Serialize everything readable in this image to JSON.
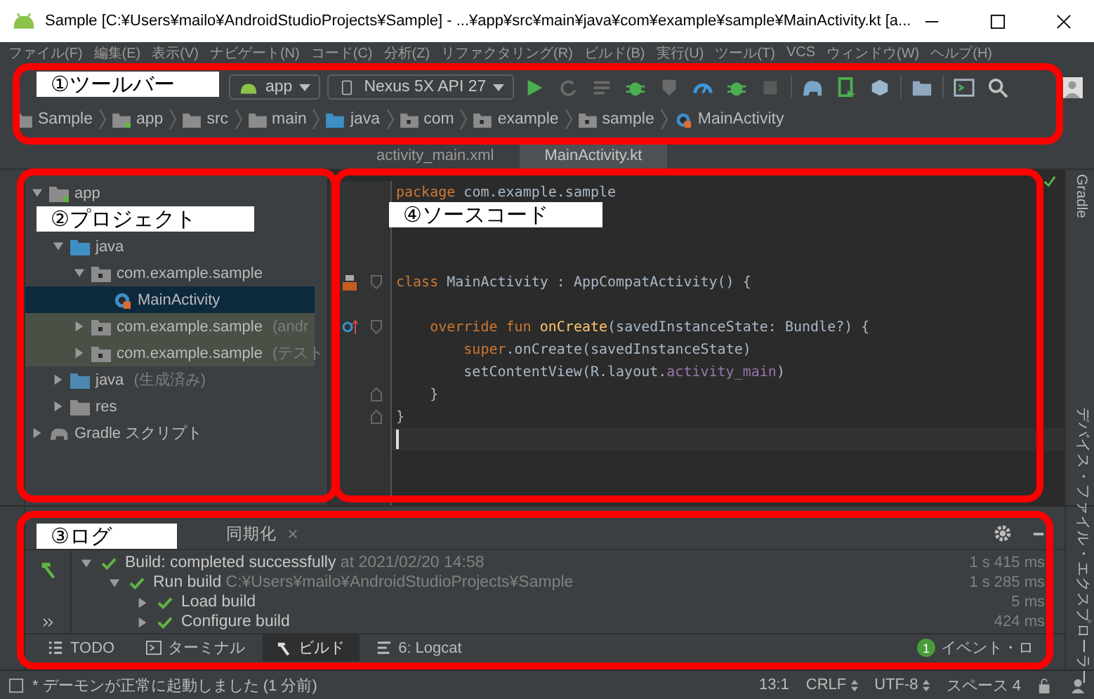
{
  "window": {
    "title": "Sample [C:¥Users¥mailo¥AndroidStudioProjects¥Sample] - ...¥app¥src¥main¥java¥com¥example¥sample¥MainActivity.kt [a..."
  },
  "menu": [
    "ファイル(F)",
    "編集(E)",
    "表示(V)",
    "ナビゲート(N)",
    "コード(C)",
    "分析(Z)",
    "リファクタリング(R)",
    "ビルド(B)",
    "実行(U)",
    "ツール(T)",
    "VCS",
    "ウィンドウ(W)",
    "ヘルプ(H)"
  ],
  "toolbar": {
    "module": "app",
    "device": "Nexus 5X API 27"
  },
  "breadcrumb": [
    {
      "label": "Sample",
      "kind": "project"
    },
    {
      "label": "app",
      "kind": "module"
    },
    {
      "label": "src",
      "kind": "folder"
    },
    {
      "label": "main",
      "kind": "folder"
    },
    {
      "label": "java",
      "kind": "source"
    },
    {
      "label": "com",
      "kind": "package"
    },
    {
      "label": "example",
      "kind": "package"
    },
    {
      "label": "sample",
      "kind": "package"
    },
    {
      "label": "MainActivity",
      "kind": "class"
    }
  ],
  "editor_tabs": [
    {
      "label": "activity_main.xml",
      "selected": false
    },
    {
      "label": "MainActivity.kt",
      "selected": true
    }
  ],
  "project_tree": [
    {
      "label": "app",
      "kind": "module",
      "expanded": true,
      "selected": false,
      "highlighted": false,
      "children": [
        {
          "label": "java",
          "kind": "source",
          "expanded": true,
          "selected": false,
          "highlighted": false,
          "children": [
            {
              "label": "com.example.sample",
              "kind": "package",
              "expanded": true,
              "selected": false,
              "highlighted": false,
              "children": [
                {
                  "label": "MainActivity",
                  "kind": "class",
                  "selected": true,
                  "highlighted": false
                }
              ]
            },
            {
              "label": "com.example.sample",
              "note": "(andr",
              "kind": "package",
              "expanded": false,
              "selected": false,
              "highlighted": true
            },
            {
              "label": "com.example.sample",
              "note": "(テスト",
              "kind": "package",
              "expanded": false,
              "selected": false,
              "highlighted": true
            }
          ]
        },
        {
          "label": "java",
          "note": "(生成済み)",
          "kind": "generated",
          "expanded": false,
          "selected": false,
          "highlighted": false
        },
        {
          "label": "res",
          "kind": "res",
          "expanded": false,
          "selected": false,
          "highlighted": false
        }
      ]
    },
    {
      "label": "Gradle スクリプト",
      "kind": "gradle",
      "expanded": false,
      "selected": false,
      "highlighted": false
    }
  ],
  "editor": {
    "lines": [
      {
        "tokens": [
          {
            "text": "package",
            "kind": "keyword"
          },
          {
            "text": " com.example.sample",
            "kind": "plain"
          }
        ]
      },
      {
        "blank": true
      },
      {
        "blank": true
      },
      {
        "blank": true
      },
      {
        "gutter_icon": {
          "kind": "layout"
        },
        "fold_marker": {
          "kind": "open"
        },
        "tokens": [
          {
            "text": "class",
            "kind": "keyword"
          },
          {
            "text": " MainActivity : AppCompatActivity() {",
            "kind": "plain"
          }
        ]
      },
      {
        "blank": true
      },
      {
        "gutter_icon": {
          "kind": "override"
        },
        "fold_marker": {
          "kind": "open"
        },
        "tokens": [
          {
            "text": "    override fun ",
            "kind": "keyword"
          },
          {
            "text": "onCreate",
            "kind": "function"
          },
          {
            "text": "(savedInstanceState: Bundle?) {",
            "kind": "plain"
          }
        ]
      },
      {
        "tokens": [
          {
            "text": "        super",
            "kind": "keyword"
          },
          {
            "text": ".onCreate(savedInstanceState)",
            "kind": "plain"
          }
        ]
      },
      {
        "tokens": [
          {
            "text": "        setContentView(R.layout.",
            "kind": "plain"
          },
          {
            "text": "activity_main",
            "kind": "property"
          },
          {
            "text": ")",
            "kind": "plain"
          }
        ]
      },
      {
        "fold_marker": {
          "kind": "close"
        },
        "tokens": [
          {
            "text": "    }",
            "kind": "plain"
          }
        ]
      },
      {
        "fold_marker": {
          "kind": "close"
        },
        "tokens": [
          {
            "text": "}",
            "kind": "plain"
          }
        ]
      },
      {
        "current": true
      }
    ]
  },
  "right_strip": [
    "Gradle",
    "デバイス・ファイル・エクスプローラー"
  ],
  "build_panel": {
    "tabs": [
      {
        "label": "同期化",
        "selected": false
      }
    ],
    "rows": [
      {
        "label": "Build:",
        "detail_bold": " completed successfully",
        "detail": " at 2021/02/20 14:58",
        "time": "1 s 415 ms",
        "expanded": true,
        "children": [
          {
            "label": "Run build",
            "detail": " C:¥Users¥mailo¥AndroidStudioProjects¥Sample",
            "time": "1 s 285 ms",
            "expanded": true,
            "children": [
              {
                "label": "Load build",
                "time": "5 ms",
                "expanded": false
              },
              {
                "label": "Configure build",
                "time": "424 ms",
                "expanded": false
              }
            ]
          }
        ]
      }
    ]
  },
  "tool_tabs": [
    {
      "label": "TODO",
      "kind": "todo",
      "selected": false
    },
    {
      "label": "ターミナル",
      "kind": "terminal",
      "selected": false
    },
    {
      "label": "ビルド",
      "kind": "build",
      "selected": true
    },
    {
      "label": "6: Logcat",
      "kind": "logcat",
      "selected": false
    }
  ],
  "event_log": {
    "count": "1",
    "label": "イベント・ロ"
  },
  "status_bar": {
    "message": "* デーモンが正常に起動しました (1 分前)",
    "position": "13:1",
    "line_ending": "CRLF",
    "encoding": "UTF-8",
    "indent": "スペース 4"
  },
  "annotations": [
    {
      "label": "①ツールバー"
    },
    {
      "label": "②プロジェクト"
    },
    {
      "label": "④ソースコード"
    },
    {
      "label": "③ログ"
    }
  ]
}
